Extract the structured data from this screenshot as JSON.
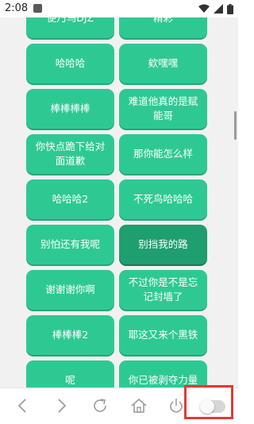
{
  "status_bar": {
    "time": "2:08",
    "icons": [
      "notification-icon",
      "wifi-icon",
      "signal-icon",
      "battery-icon"
    ]
  },
  "buttons": [
    [
      "便乃乌DJZ",
      "精彩"
    ],
    [
      "哈哈哈",
      "欸嘿嘿"
    ],
    [
      "棒棒棒棒",
      "难道他真的是赋能哥"
    ],
    [
      "你快点跪下给对面道歉",
      "那你能怎么样"
    ],
    [
      "哈哈哈2",
      "不死鸟哈哈哈"
    ],
    [
      "别怕还有我呢",
      "别挡我的路"
    ],
    [
      "谢谢谢你啊",
      "不过你是不是忘记封墙了"
    ],
    [
      "棒棒棒2",
      "耶这又来个黑铁"
    ],
    [
      "呢",
      "你已被剥夺力量"
    ]
  ],
  "active_button": "别挡我的路",
  "toolbar": {
    "icons": [
      "back-icon",
      "forward-icon",
      "refresh-icon",
      "home-icon",
      "power-icon",
      "toggle-switch"
    ],
    "toggle_on": false
  },
  "colors": {
    "button_bg": "#2ec993",
    "button_active_bg": "#1f9e6f",
    "highlight_border": "#e53935"
  }
}
